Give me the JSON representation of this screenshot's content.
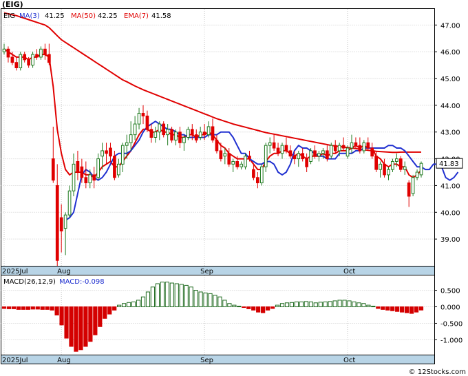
{
  "title": "(EIG)",
  "legend": {
    "symbol": "EIG",
    "ma3_label": "MA(3)",
    "ma3_value": "41.25",
    "ma50_label": "MA(50)",
    "ma50_value": "42.25",
    "ema7_label": "EMA(7)",
    "ema7_value": "41.58"
  },
  "macd_legend": {
    "label": "MACD(26,12,9)",
    "value_label": "MACD:-0.098"
  },
  "last_price_label": "41.83",
  "copyright": "© 12Stocks.com",
  "colors": {
    "up": "#1f7a1f",
    "down": "#e00000",
    "ma3": "#2030d0",
    "ma50": "#e00000",
    "hist_pos": "#1f6a1f",
    "hist_neg": "#d40000",
    "axis_band": "#b8d4e6"
  },
  "chart_data": [
    {
      "type": "candlestick",
      "title": "(EIG)",
      "ylim": [
        38,
        47.6
      ],
      "y_ticks": [
        "39.00",
        "40.00",
        "41.00",
        "42.00",
        "43.00",
        "44.00",
        "45.00",
        "46.00",
        "47.00"
      ],
      "x_tick_labels": [
        {
          "label": "2025Jul",
          "index": 0
        },
        {
          "label": "Aug",
          "index": 14
        },
        {
          "label": "Sep",
          "index": 49
        },
        {
          "label": "Oct",
          "index": 84
        }
      ],
      "grid": true,
      "candles": [
        [
          46.0,
          46.3,
          45.9,
          46.1
        ],
        [
          46.1,
          46.2,
          45.6,
          45.8
        ],
        [
          45.8,
          46.0,
          45.5,
          45.6
        ],
        [
          45.6,
          45.8,
          45.3,
          45.4
        ],
        [
          45.4,
          46.0,
          45.3,
          45.9
        ],
        [
          45.9,
          46.0,
          45.6,
          45.7
        ],
        [
          45.7,
          45.8,
          45.4,
          45.5
        ],
        [
          45.5,
          46.0,
          45.4,
          45.9
        ],
        [
          45.9,
          46.1,
          45.7,
          45.8
        ],
        [
          45.8,
          46.2,
          45.7,
          46.1
        ],
        [
          46.1,
          46.3,
          45.7,
          45.9
        ],
        [
          45.9,
          46.3,
          45.5,
          45.6
        ],
        [
          42.0,
          43.2,
          41.1,
          41.2
        ],
        [
          41.0,
          41.8,
          38.0,
          38.2
        ],
        [
          39.8,
          40.3,
          38.5,
          39.3
        ],
        [
          39.4,
          40.0,
          38.4,
          39.9
        ],
        [
          39.9,
          41.0,
          39.8,
          40.8
        ],
        [
          40.8,
          42.2,
          40.6,
          41.8
        ],
        [
          41.9,
          42.3,
          41.2,
          41.5
        ],
        [
          41.7,
          42.0,
          41.1,
          41.3
        ],
        [
          41.3,
          41.9,
          40.9,
          41.1
        ],
        [
          41.1,
          41.6,
          40.9,
          41.4
        ],
        [
          41.4,
          41.7,
          40.9,
          41.2
        ],
        [
          41.3,
          42.2,
          41.2,
          42.0
        ],
        [
          42.1,
          42.6,
          41.6,
          42.3
        ],
        [
          42.3,
          42.6,
          41.8,
          42.2
        ],
        [
          42.4,
          42.6,
          41.9,
          42.1
        ],
        [
          42.1,
          42.3,
          41.2,
          41.3
        ],
        [
          41.4,
          42.0,
          41.3,
          41.8
        ],
        [
          41.8,
          42.6,
          41.5,
          42.5
        ],
        [
          42.5,
          42.9,
          42.0,
          42.6
        ],
        [
          42.6,
          43.4,
          42.3,
          42.9
        ],
        [
          42.9,
          43.6,
          42.7,
          43.3
        ],
        [
          43.3,
          43.9,
          43.1,
          43.7
        ],
        [
          43.7,
          44.0,
          43.3,
          43.6
        ],
        [
          43.6,
          43.8,
          43.0,
          43.1
        ],
        [
          43.1,
          43.3,
          42.6,
          42.8
        ],
        [
          42.8,
          43.2,
          42.6,
          43.0
        ],
        [
          43.0,
          43.4,
          42.7,
          43.3
        ],
        [
          43.3,
          43.4,
          42.8,
          42.9
        ],
        [
          42.9,
          43.3,
          42.5,
          43.1
        ],
        [
          43.1,
          43.2,
          42.6,
          42.7
        ],
        [
          42.7,
          43.1,
          42.5,
          43.0
        ],
        [
          43.0,
          43.2,
          42.4,
          42.6
        ],
        [
          42.6,
          42.9,
          42.3,
          42.8
        ],
        [
          42.8,
          43.2,
          42.7,
          43.1
        ],
        [
          43.1,
          43.3,
          42.7,
          42.9
        ],
        [
          42.9,
          43.1,
          42.6,
          42.7
        ],
        [
          42.8,
          43.2,
          42.7,
          43.0
        ],
        [
          43.0,
          43.3,
          42.7,
          42.9
        ],
        [
          42.9,
          43.4,
          42.8,
          43.2
        ],
        [
          43.2,
          43.5,
          42.6,
          42.7
        ],
        [
          42.7,
          42.9,
          42.2,
          42.3
        ],
        [
          42.3,
          42.6,
          41.9,
          42.0
        ],
        [
          42.1,
          42.4,
          41.8,
          42.2
        ],
        [
          42.2,
          42.4,
          41.7,
          41.8
        ],
        [
          41.8,
          42.0,
          41.5,
          41.9
        ],
        [
          41.9,
          42.1,
          41.6,
          41.7
        ],
        [
          41.7,
          41.9,
          41.6,
          41.8
        ],
        [
          41.7,
          42.2,
          41.6,
          42.1
        ],
        [
          42.1,
          42.3,
          41.9,
          42.0
        ],
        [
          41.6,
          41.8,
          41.2,
          41.3
        ],
        [
          41.3,
          41.5,
          40.9,
          41.1
        ],
        [
          41.1,
          41.8,
          41.0,
          41.7
        ],
        [
          41.7,
          42.6,
          41.5,
          42.5
        ],
        [
          42.5,
          42.8,
          42.2,
          42.6
        ],
        [
          42.6,
          42.9,
          42.3,
          42.4
        ],
        [
          42.4,
          42.6,
          42.1,
          42.2
        ],
        [
          42.2,
          42.6,
          42.0,
          42.5
        ],
        [
          42.5,
          42.8,
          42.2,
          42.3
        ],
        [
          42.3,
          42.5,
          42.0,
          42.1
        ],
        [
          42.1,
          42.3,
          41.8,
          42.0
        ],
        [
          42.0,
          42.3,
          41.7,
          42.2
        ],
        [
          42.2,
          42.4,
          41.9,
          42.0
        ],
        [
          42.0,
          42.2,
          41.5,
          41.7
        ],
        [
          41.9,
          42.4,
          41.8,
          42.3
        ],
        [
          42.3,
          42.5,
          42.0,
          42.1
        ],
        [
          42.1,
          42.3,
          41.9,
          42.2
        ],
        [
          42.2,
          42.4,
          42.0,
          42.3
        ],
        [
          42.3,
          42.5,
          41.9,
          42.0
        ],
        [
          42.1,
          42.6,
          42.0,
          42.5
        ],
        [
          42.5,
          42.7,
          42.2,
          42.3
        ],
        [
          42.3,
          42.6,
          42.1,
          42.5
        ],
        [
          42.5,
          42.8,
          42.3,
          42.4
        ],
        [
          42.1,
          42.5,
          42.0,
          42.4
        ],
        [
          42.4,
          42.9,
          42.2,
          42.6
        ],
        [
          42.6,
          42.8,
          42.4,
          42.5
        ],
        [
          42.5,
          42.8,
          42.2,
          42.3
        ],
        [
          42.3,
          42.7,
          42.2,
          42.6
        ],
        [
          42.6,
          42.8,
          42.3,
          42.4
        ],
        [
          42.4,
          42.6,
          42.0,
          42.1
        ],
        [
          42.1,
          42.3,
          41.5,
          41.6
        ],
        [
          41.6,
          41.9,
          41.3,
          41.8
        ],
        [
          41.8,
          42.0,
          41.3,
          41.4
        ],
        [
          41.4,
          41.7,
          41.2,
          41.6
        ],
        [
          41.6,
          42.0,
          41.5,
          41.9
        ],
        [
          41.9,
          42.2,
          41.7,
          42.0
        ],
        [
          42.0,
          42.1,
          41.5,
          41.6
        ],
        [
          41.6,
          41.9,
          41.4,
          41.7
        ],
        [
          41.1,
          41.2,
          40.2,
          40.6
        ],
        [
          40.7,
          41.4,
          40.6,
          41.3
        ],
        [
          41.3,
          41.6,
          41.2,
          41.5
        ],
        [
          41.4,
          41.9,
          41.3,
          41.83
        ]
      ],
      "series": [
        {
          "name": "MA(3)",
          "color": "#2030d0",
          "start": 15,
          "values": [
            39.7,
            39.8,
            40.0,
            40.7,
            41.4,
            41.6,
            41.5,
            41.3,
            41.2,
            41.3,
            41.5,
            41.8,
            42.1,
            42.2,
            42.2,
            42.2,
            42.3,
            42.5,
            42.7,
            43.0,
            43.2,
            43.3,
            43.4,
            43.3,
            43.2,
            43.1,
            43.1,
            43.0,
            42.9,
            42.9,
            42.8,
            42.8,
            42.8,
            42.8,
            42.8,
            42.9,
            42.9,
            42.9,
            43.0,
            43.0,
            43.0,
            42.8,
            42.5,
            42.2,
            42.2,
            42.0,
            41.9,
            41.8,
            41.8,
            41.9,
            41.9,
            41.8,
            41.5,
            41.4,
            41.5,
            41.8,
            42.3,
            42.5,
            42.4,
            42.4,
            42.3,
            42.2,
            42.1,
            42.1,
            42.0,
            42.0,
            42.0,
            42.2,
            42.2,
            42.2,
            42.2,
            42.3,
            42.3,
            42.4,
            42.4,
            42.4,
            42.4,
            42.4,
            42.4,
            42.5,
            42.5,
            42.4,
            42.4,
            42.3,
            42.1,
            41.9,
            41.7,
            41.7,
            41.6,
            41.6,
            41.8,
            41.8,
            41.7,
            41.3,
            41.2,
            41.3,
            41.5
          ]
        },
        {
          "name": "MA(50)",
          "color": "#e00000",
          "start": 0,
          "values": [
            47.45,
            47.42,
            47.38,
            47.35,
            47.3,
            47.25,
            47.2,
            47.15,
            47.1,
            47.05,
            47.0,
            46.9,
            46.75,
            46.6,
            46.45,
            46.35,
            46.25,
            46.15,
            46.05,
            45.95,
            45.85,
            45.75,
            45.65,
            45.55,
            45.45,
            45.35,
            45.25,
            45.15,
            45.05,
            44.95,
            44.88,
            44.8,
            44.72,
            44.65,
            44.58,
            44.52,
            44.46,
            44.4,
            44.34,
            44.28,
            44.22,
            44.16,
            44.1,
            44.04,
            43.98,
            43.92,
            43.86,
            43.8,
            43.74,
            43.68,
            43.62,
            43.56,
            43.5,
            43.45,
            43.4,
            43.35,
            43.3,
            43.26,
            43.22,
            43.18,
            43.14,
            43.1,
            43.06,
            43.02,
            42.98,
            42.95,
            42.92,
            42.89,
            42.86,
            42.83,
            42.8,
            42.77,
            42.74,
            42.71,
            42.68,
            42.65,
            42.62,
            42.59,
            42.56,
            42.53,
            42.5,
            42.48,
            42.46,
            42.44,
            42.42,
            42.4,
            42.38,
            42.36,
            42.34,
            42.32,
            42.3,
            42.28,
            42.27,
            42.26,
            42.25,
            42.24,
            42.24,
            42.25,
            42.25,
            42.25,
            42.25,
            42.25,
            42.25
          ]
        },
        {
          "name": "EMA(7)",
          "color": "#e00000",
          "start": 0,
          "values": [
            46.1,
            46.0,
            45.9,
            45.8,
            45.8,
            45.8,
            45.7,
            45.8,
            45.8,
            45.9,
            45.9,
            45.8,
            44.7,
            43.1,
            42.2,
            41.6,
            41.4,
            41.5,
            41.5,
            41.5,
            41.4,
            41.4,
            41.3,
            41.5,
            41.7,
            41.8,
            41.9,
            41.7,
            41.7,
            41.9,
            42.1,
            42.3,
            42.6,
            42.9,
            43.1,
            43.1,
            43.0,
            43.0,
            43.1,
            43.0,
            43.0,
            42.9,
            42.9,
            42.8,
            42.8,
            42.9,
            42.9,
            42.8,
            42.9,
            42.9,
            43.0,
            42.9,
            42.7,
            42.5,
            42.4,
            42.2,
            42.1,
            42.0,
            42.0,
            42.0,
            42.0,
            41.8,
            41.6,
            41.6,
            41.9,
            42.1,
            42.2,
            42.2,
            42.3,
            42.3,
            42.2,
            42.1,
            42.2,
            42.1,
            42.0,
            42.1,
            42.1,
            42.1,
            42.2,
            42.1,
            42.2,
            42.2,
            42.3,
            42.3,
            42.3,
            42.4,
            42.5,
            42.4,
            42.5,
            42.4,
            42.4,
            42.1,
            42.0,
            41.8,
            41.7,
            41.8,
            41.8,
            41.7,
            41.7,
            41.4,
            41.3,
            41.4,
            41.58
          ]
        }
      ]
    },
    {
      "type": "bar",
      "title": "MACD(26,12,9)",
      "ylim": [
        -1.45,
        0.95
      ],
      "y_ticks": [
        "0.500",
        "0.000",
        "-0.500",
        "-1.000"
      ],
      "x_tick_labels": [
        {
          "label": "2025Jul",
          "index": 0
        },
        {
          "label": "Aug",
          "index": 14
        },
        {
          "label": "Sep",
          "index": 49
        },
        {
          "label": "Oct",
          "index": 84
        }
      ],
      "values": [
        -0.05,
        -0.06,
        -0.06,
        -0.08,
        -0.08,
        -0.08,
        -0.07,
        -0.07,
        -0.08,
        -0.08,
        -0.1,
        -0.25,
        -0.55,
        -0.95,
        -1.2,
        -1.35,
        -1.3,
        -1.2,
        -1.05,
        -0.85,
        -0.6,
        -0.35,
        -0.22,
        -0.1,
        0.05,
        0.1,
        0.13,
        0.15,
        0.2,
        0.3,
        0.45,
        0.6,
        0.7,
        0.75,
        0.75,
        0.72,
        0.7,
        0.68,
        0.65,
        0.6,
        0.5,
        0.45,
        0.42,
        0.4,
        0.35,
        0.3,
        0.2,
        0.1,
        0.05,
        0.02,
        -0.02,
        -0.06,
        -0.1,
        -0.16,
        -0.18,
        -0.1,
        -0.05,
        0.05,
        0.1,
        0.12,
        0.13,
        0.15,
        0.15,
        0.16,
        0.15,
        0.12,
        0.14,
        0.15,
        0.16,
        0.18,
        0.2,
        0.2,
        0.18,
        0.15,
        0.12,
        0.1,
        0.05,
        0.02,
        -0.05,
        -0.08,
        -0.1,
        -0.12,
        -0.14,
        -0.16,
        -0.18,
        -0.2,
        -0.16,
        -0.098
      ]
    }
  ]
}
